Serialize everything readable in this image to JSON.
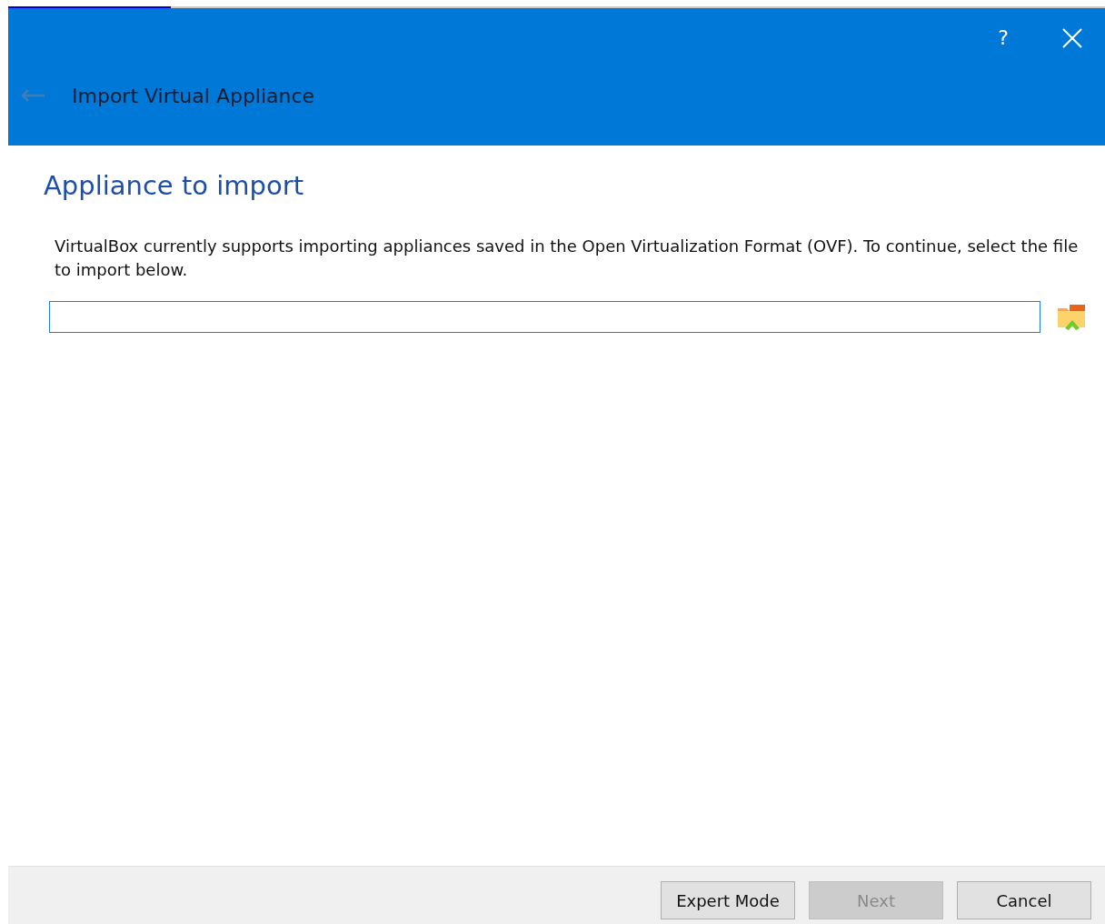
{
  "window": {
    "title": "Import Virtual Appliance",
    "help": "?",
    "back_disabled": true
  },
  "page": {
    "heading": "Appliance to import",
    "description": "VirtualBox currently supports importing appliances saved in the Open Virtualization Format (OVF). To continue, select the file to import below."
  },
  "buttons": [
    {
      "label": "Expert Mode",
      "disabled": false
    },
    {
      "label": "Next",
      "disabled": true
    },
    {
      "label": "Cancel",
      "disabled": false
    }
  ]
}
